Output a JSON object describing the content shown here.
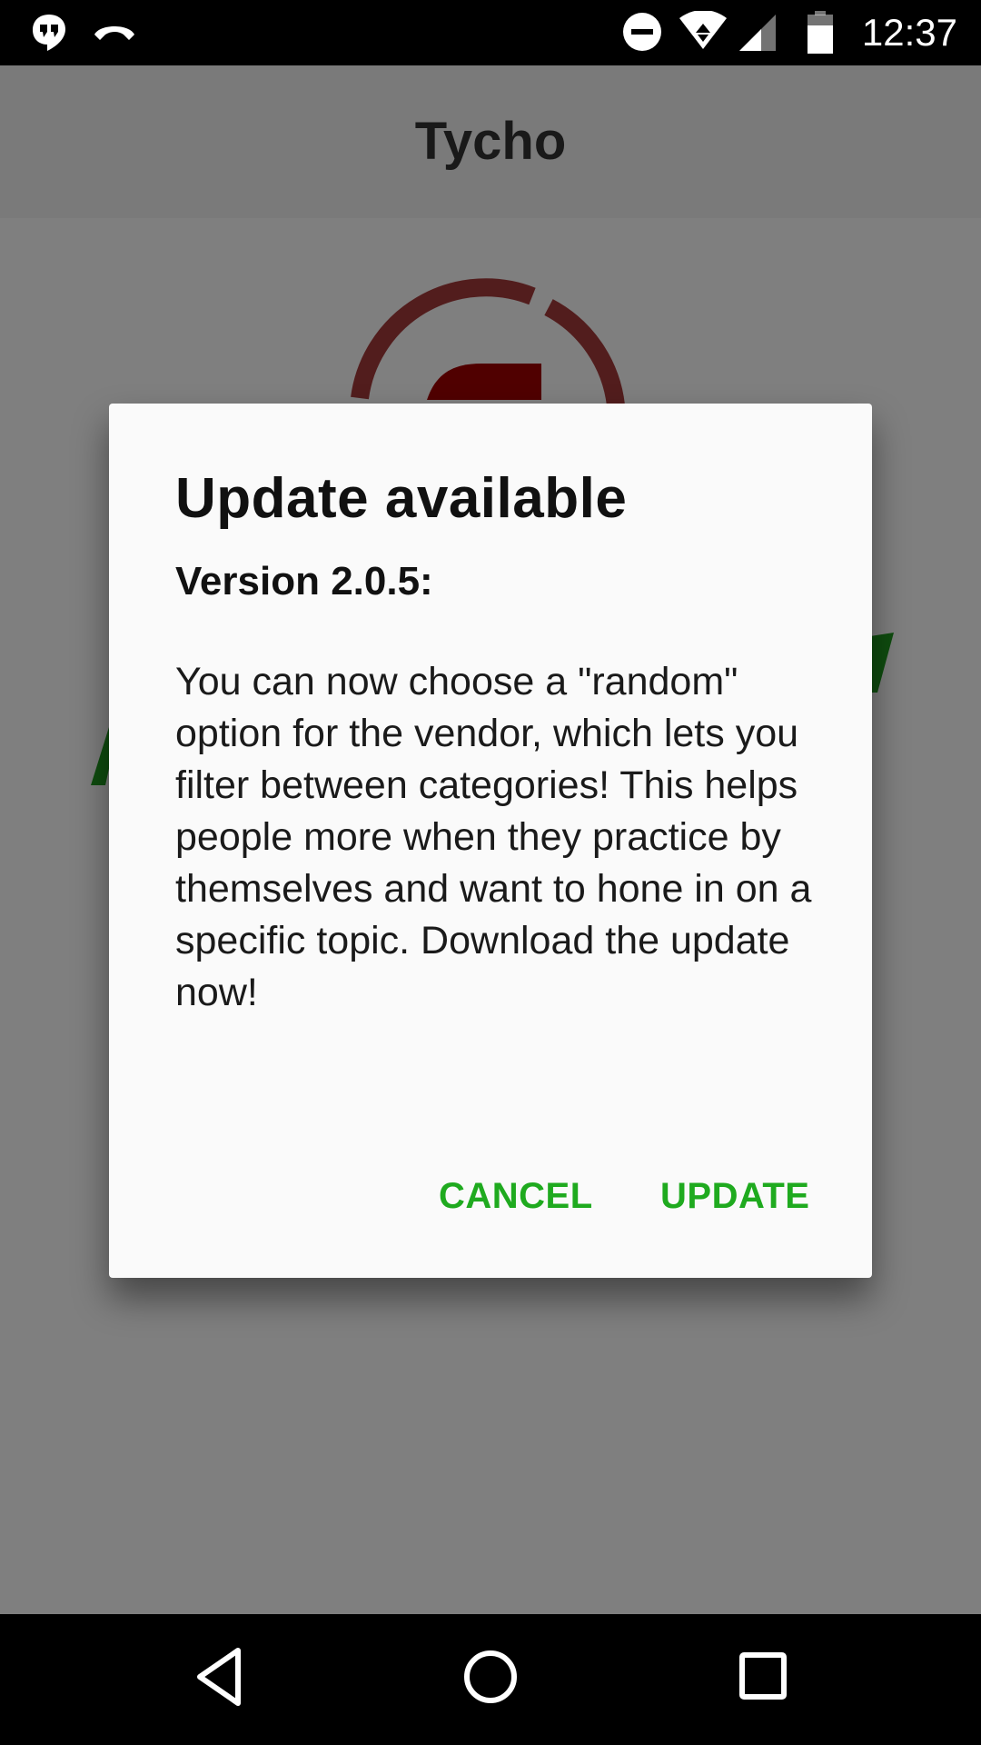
{
  "status_bar": {
    "time": "12:37",
    "icons": [
      "hangouts-icon",
      "headset-icon",
      "do-not-disturb-icon",
      "wifi-icon",
      "signal-icon",
      "battery-icon"
    ]
  },
  "app_bar": {
    "title": "Tycho"
  },
  "dialog": {
    "title": "Update available",
    "version": "Version 2.0.5:",
    "message": "You can now choose a \"random\" option for the vendor, which lets you filter between categories! This helps people more when they practice by themselves and want to hone in on a specific topic. Download the update now!",
    "cancel_label": "CANCEL",
    "update_label": "UPDATE"
  },
  "nav_bar": {
    "buttons": [
      "back-icon",
      "home-icon",
      "recents-icon"
    ]
  },
  "colors": {
    "accent": "#1faa1f",
    "logo_red": "#a00000",
    "logo_green": "#1f9a1f"
  }
}
